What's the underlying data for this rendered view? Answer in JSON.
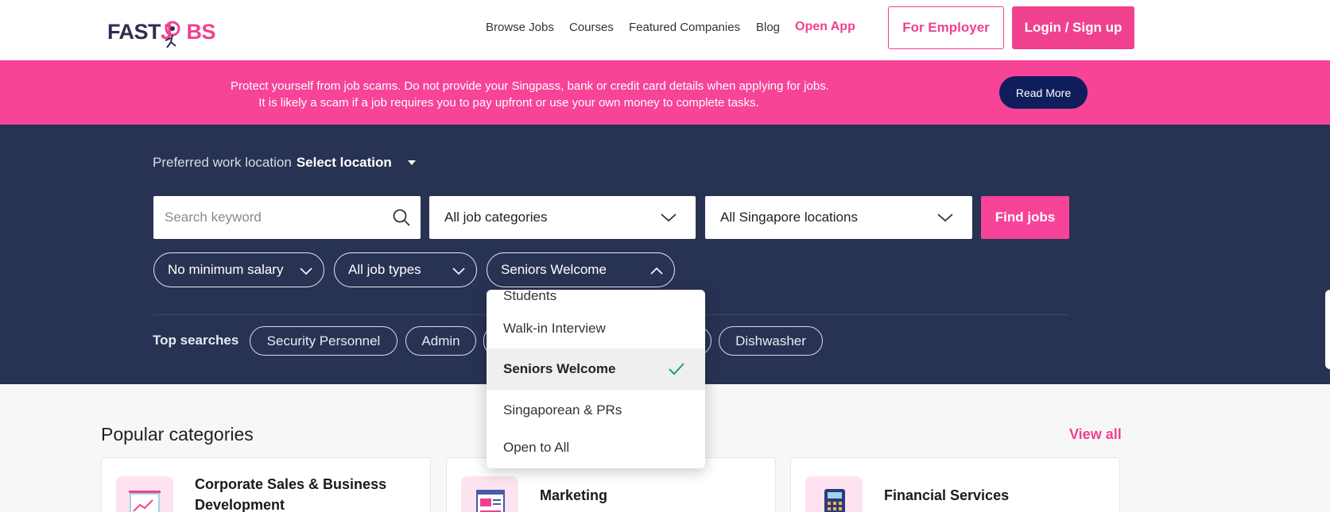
{
  "header": {
    "logo_fast": "FAST",
    "logo_jobs": "J",
    "logo_jobs_end": "BS",
    "nav": [
      "Browse Jobs",
      "Courses",
      "Featured Companies",
      "Blog"
    ],
    "open_app": "Open App",
    "employer_button": "For Employer",
    "login_button": "Login / Sign up"
  },
  "banner": {
    "line1": "Protect yourself from job scams. Do not provide your Singpass, bank or credit card details when applying for jobs.",
    "line2": "It is likely a scam if a job requires you to pay upfront or use your own money to complete tasks.",
    "read_more": "Read More"
  },
  "search": {
    "location_label": "Preferred work location",
    "location_value": "Select location",
    "keyword_placeholder": "Search keyword",
    "category_value": "All job categories",
    "location_select_value": "All Singapore locations",
    "find_button": "Find jobs",
    "salary_filter": "No minimum salary",
    "job_type_filter": "All job types",
    "audience_filter": "Seniors Welcome"
  },
  "top_searches": {
    "label": "Top searches",
    "tags": [
      "Security Personnel",
      "Admin",
      "",
      "",
      "Dishwasher"
    ]
  },
  "dropdown": {
    "items": [
      {
        "label": "Students",
        "selected": false
      },
      {
        "label": "Walk-in Interview",
        "selected": false
      },
      {
        "label": "Seniors Welcome",
        "selected": true
      },
      {
        "label": "Singaporean & PRs",
        "selected": false
      },
      {
        "label": "Open to All",
        "selected": false
      }
    ]
  },
  "popular": {
    "title": "Popular categories",
    "view_all": "View all",
    "cards": [
      {
        "title_line1": "Corporate Sales & Business",
        "title_line2": "Development",
        "icon": "sales-chart-icon"
      },
      {
        "title_line1": "Marketing",
        "title_line2": "",
        "icon": "newspaper-icon"
      },
      {
        "title_line1": "Financial Services",
        "title_line2": "",
        "icon": "calculator-icon"
      }
    ]
  },
  "colors": {
    "brand_pink": "#f0418f",
    "hero_navy": "#283253",
    "read_more_navy": "#0f1d5a",
    "check_green": "#1e9a6e"
  }
}
